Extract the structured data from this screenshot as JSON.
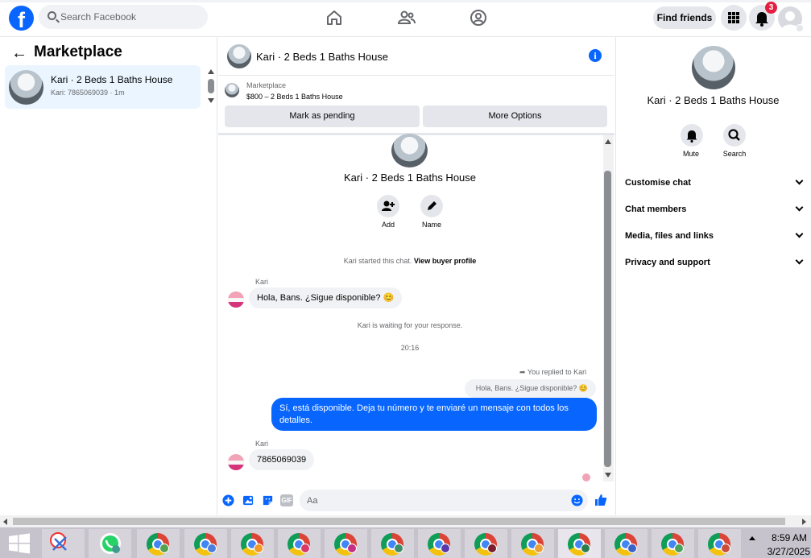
{
  "topnav": {
    "search_placeholder": "Search Facebook",
    "find_friends_label": "Find friends",
    "notification_count": "3",
    "logo_letter": "f"
  },
  "left": {
    "title": "Marketplace",
    "conversation": {
      "name": "Kari · 2 Beds 1 Baths House",
      "sub": "Kari: 7865069039 · 1m"
    }
  },
  "chat": {
    "header_title": "Kari · 2 Beds 1 Baths House",
    "listing_label": "Marketplace",
    "listing_price": "$800 – 2 Beds 1 Baths House",
    "mark_pending_label": "Mark as pending",
    "more_options_label": "More Options",
    "big_title": "Kari · 2 Beds 1 Baths House",
    "add_label": "Add",
    "name_label": "Name",
    "started_text": "Kari started this chat.",
    "view_buyer_profile": "View buyer profile",
    "msg1_sender": "Kari",
    "msg1_text": "Hola, Bans. ¿Sigue disponible? 😊",
    "waiting_text": "Kari is waiting for your response.",
    "time_stamp": "20:16",
    "replied_to": "You replied to Kari",
    "quoted_text": "Hola, Bans. ¿Sigue disponible? 😊",
    "my_reply": "Sí, está disponible. Deja tu número y te enviaré un mensaje con todos los detalles.",
    "msg2_sender": "Kari",
    "msg2_text": "7865069039",
    "composer_placeholder": "Aa",
    "gif_label": "GIF"
  },
  "right": {
    "title": "Kari · 2 Beds 1 Baths House",
    "mute_label": "Mute",
    "search_label": "Search",
    "menu": [
      "Customise chat",
      "Chat members",
      "Media, files and links",
      "Privacy and support"
    ]
  },
  "taskbar": {
    "time": "8:59 AM",
    "date": "3/27/2025"
  },
  "colors": {
    "accent": "#0866ff",
    "badge": "#e41e3f",
    "selected": "#ebf5ff"
  }
}
